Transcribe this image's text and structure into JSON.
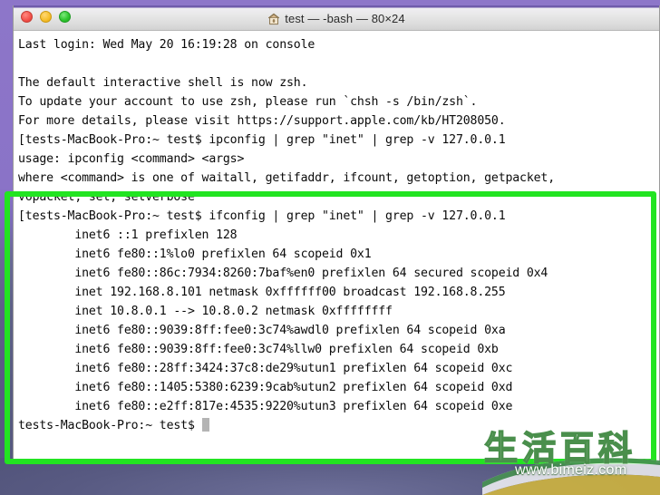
{
  "desktop": {
    "background_top_color": "#8d76c9",
    "background_bottom_color": "#55567e"
  },
  "window": {
    "title": "test — -bash — 80×24",
    "home_icon": "home-icon",
    "traffic_lights": [
      {
        "name": "close",
        "color": "#f4544d"
      },
      {
        "name": "minimize",
        "color": "#f7c02e"
      },
      {
        "name": "maximize",
        "color": "#2fc62f"
      }
    ]
  },
  "terminal": {
    "lines": [
      "Last login: Wed May 20 16:19:28 on console",
      "",
      "The default interactive shell is now zsh.",
      "To update your account to use zsh, please run `chsh -s /bin/zsh`.",
      "For more details, please visit https://support.apple.com/kb/HT208050.",
      "[tests-MacBook-Pro:~ test$ ipconfig | grep \"inet\" | grep -v 127.0.0.1",
      "usage: ipconfig <command> <args>",
      "where <command> is one of waitall, getifaddr, ifcount, getoption, getpacket,",
      "v6packet, set, setverbose",
      "[tests-MacBook-Pro:~ test$ ifconfig | grep \"inet\" | grep -v 127.0.0.1",
      "        inet6 ::1 prefixlen 128",
      "        inet6 fe80::1%lo0 prefixlen 64 scopeid 0x1",
      "        inet6 fe80::86c:7934:8260:7baf%en0 prefixlen 64 secured scopeid 0x4",
      "        inet 192.168.8.101 netmask 0xffffff00 broadcast 192.168.8.255",
      "        inet 10.8.0.1 --> 10.8.0.2 netmask 0xffffffff",
      "        inet6 fe80::9039:8ff:fee0:3c74%awdl0 prefixlen 64 scopeid 0xa",
      "        inet6 fe80::9039:8ff:fee0:3c74%llw0 prefixlen 64 scopeid 0xb",
      "        inet6 fe80::28ff:3424:37c8:de29%utun1 prefixlen 64 scopeid 0xc",
      "        inet6 fe80::1405:5380:6239:9cab%utun2 prefixlen 64 scopeid 0xd",
      "        inet6 fe80::e2ff:817e:4535:9220%utun3 prefixlen 64 scopeid 0xe"
    ],
    "final_prompt": "tests-MacBook-Pro:~ test$ ",
    "cursor": "block-cursor"
  },
  "highlight": {
    "color": "#22e421",
    "label": "green-highlight-box"
  },
  "watermark": {
    "cn_text": "生活百科",
    "url": "www.bimeiz.com",
    "color": "#4a8f4c"
  }
}
